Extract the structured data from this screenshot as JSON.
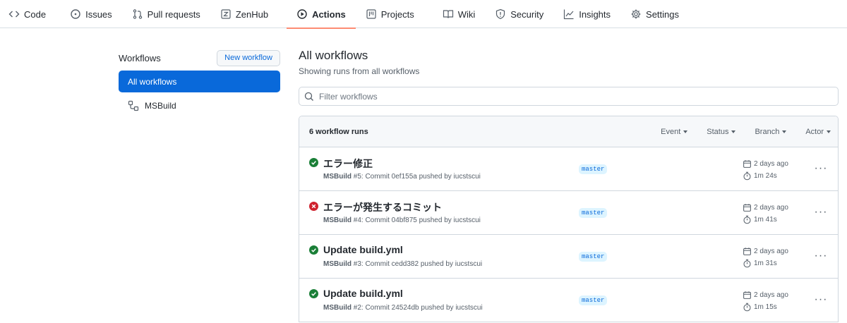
{
  "repo_nav": {
    "tabs": [
      {
        "label": "Code",
        "icon": "code-icon"
      },
      {
        "label": "Issues",
        "icon": "issue-icon"
      },
      {
        "label": "Pull requests",
        "icon": "pull-request-icon"
      },
      {
        "label": "ZenHub",
        "icon": "zenhub-icon"
      },
      {
        "label": "Actions",
        "icon": "play-icon"
      },
      {
        "label": "Projects",
        "icon": "project-icon"
      },
      {
        "label": "Wiki",
        "icon": "book-icon"
      },
      {
        "label": "Security",
        "icon": "shield-icon"
      },
      {
        "label": "Insights",
        "icon": "graph-icon"
      },
      {
        "label": "Settings",
        "icon": "gear-icon"
      }
    ],
    "active": "Actions"
  },
  "sidebar": {
    "title": "Workflows",
    "new_button": "New workflow",
    "items": [
      {
        "label": "All workflows",
        "selected": true
      },
      {
        "label": "MSBuild",
        "icon": "workflow-icon"
      }
    ]
  },
  "main": {
    "title": "All workflows",
    "subtitle": "Showing runs from all workflows",
    "filter_placeholder": "Filter workflows",
    "runs_count": "6 workflow runs",
    "filters": [
      "Event",
      "Status",
      "Branch",
      "Actor"
    ],
    "runs": [
      {
        "status": "success",
        "title": "エラー修正",
        "workflow": "MSBuild",
        "meta": " #5: Commit 0ef155a pushed by iucstscui",
        "branch": "master",
        "date": "2 days ago",
        "duration": "1m 24s"
      },
      {
        "status": "failure",
        "title": "エラーが発生するコミット",
        "workflow": "MSBuild",
        "meta": " #4: Commit 04bf875 pushed by iucstscui",
        "branch": "master",
        "date": "2 days ago",
        "duration": "1m 41s"
      },
      {
        "status": "success",
        "title": "Update build.yml",
        "workflow": "MSBuild",
        "meta": " #3: Commit cedd382 pushed by iucstscui",
        "branch": "master",
        "date": "2 days ago",
        "duration": "1m 31s"
      },
      {
        "status": "success",
        "title": "Update build.yml",
        "workflow": "MSBuild",
        "meta": " #2: Commit 24524db pushed by iucstscui",
        "branch": "master",
        "date": "2 days ago",
        "duration": "1m 15s"
      }
    ]
  },
  "colors": {
    "accent": "#0969da",
    "success": "#1a7f37",
    "failure": "#cf222e",
    "active_underline": "#fd8c73"
  }
}
